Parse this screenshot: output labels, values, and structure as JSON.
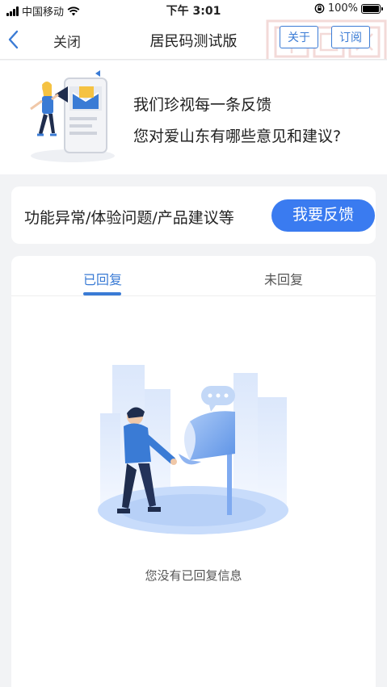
{
  "status_bar": {
    "carrier": "中国移动",
    "time": "下午 3:01",
    "battery": "100%"
  },
  "navbar": {
    "close_label": "关闭",
    "title": "居民码测试版",
    "about_label": "关于",
    "subscribe_label": "订阅"
  },
  "banner": {
    "line1": "我们珍视每一条反馈",
    "line2": "您对爱山东有哪些意见和建议?"
  },
  "feedback_card": {
    "hint": "功能异常/体验问题/产品建议等",
    "button_label": "我要反馈"
  },
  "tabs": [
    {
      "label": "已回复",
      "active": true
    },
    {
      "label": "未回复",
      "active": false
    }
  ],
  "empty_state": {
    "message": "您没有已回复信息"
  },
  "colors": {
    "accent": "#3a7bd5",
    "cta": "#3a7bf0",
    "background": "#f2f3f5"
  }
}
